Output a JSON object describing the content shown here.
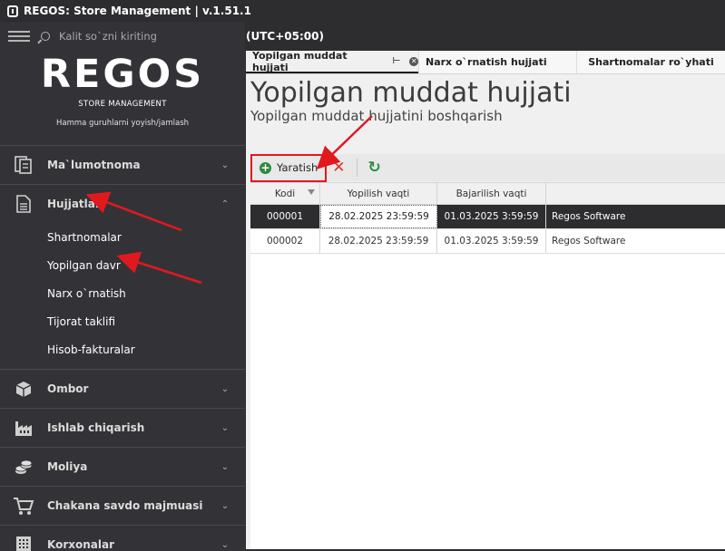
{
  "window": {
    "title": "REGOS: Store Management | v.1.51.1"
  },
  "search": {
    "placeholder": "Kalit so`zni kiriting"
  },
  "logo": {
    "main": "REGOS",
    "sub": "STORE MANAGEMENT",
    "tagline": "Hamma guruhlarni yoyish/jamlash"
  },
  "timezone": "(UTC+05:00)",
  "sidebar": {
    "sections": [
      {
        "label": "Ma`lumotnoma",
        "icon": "reference-book-icon"
      },
      {
        "label": "Hujjatlar",
        "icon": "document-icon",
        "expanded": true
      },
      {
        "label": "Ombor",
        "icon": "warehouse-box-icon"
      },
      {
        "label": "Ishlab chiqarish",
        "icon": "factory-icon"
      },
      {
        "label": "Moliya",
        "icon": "coins-icon"
      },
      {
        "label": "Chakana savdo majmuasi",
        "icon": "shopping-cart-icon"
      },
      {
        "label": "Korxonalar",
        "icon": "building-icon"
      }
    ],
    "documents_items": [
      "Shartnomalar",
      "Yopilgan davr",
      "Narx o`rnatish",
      "Tijorat taklifi",
      "Hisob-fakturalar"
    ]
  },
  "tabs": [
    {
      "label": "Yopilgan muddat hujjati",
      "active": true
    },
    {
      "label": "Narx o`rnatish hujjati"
    },
    {
      "label": "Shartnomalar ro`yhati"
    }
  ],
  "page": {
    "title": "Yopilgan muddat hujjati",
    "subtitle": "Yopilgan muddat hujjatini boshqarish"
  },
  "toolbar": {
    "create_label": "Yaratish"
  },
  "grid": {
    "columns": [
      "Kodi",
      "Yopilish vaqti",
      "Bajarilish vaqti",
      ""
    ],
    "rows": [
      [
        "000001",
        "28.02.2025 23:59:59",
        "01.03.2025 3:59:59",
        "Regos Software"
      ],
      [
        "000002",
        "28.02.2025 23:59:59",
        "01.03.2025 3:59:59",
        "Regos Software"
      ]
    ]
  },
  "colors": {
    "accent_red": "#e0191f",
    "dark_bg": "#2d2d30",
    "green": "#2e8b3e"
  }
}
